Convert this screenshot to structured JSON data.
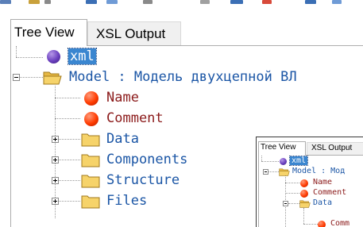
{
  "tabs": [
    {
      "label": "Tree View",
      "active": true
    },
    {
      "label": "XSL Output",
      "active": false
    }
  ],
  "tree": {
    "root": {
      "label": "xml",
      "selected": true,
      "icon": "purple-node-icon"
    },
    "model": {
      "label": "Model  : Модель двухцепной ВЛ",
      "icon": "folder-icon",
      "expanded": true
    },
    "items": [
      {
        "label": "Name",
        "icon": "red-node-icon"
      },
      {
        "label": "Comment",
        "icon": "red-node-icon"
      },
      {
        "label": "Data",
        "icon": "folder-icon",
        "expandable": true
      },
      {
        "label": "Components",
        "icon": "folder-icon",
        "expandable": true
      },
      {
        "label": "Structure",
        "icon": "folder-icon",
        "expandable": true
      },
      {
        "label": "Files",
        "icon": "folder-icon",
        "expandable": true
      }
    ]
  },
  "inset": {
    "tabs": [
      {
        "label": "Tree View",
        "active": true
      },
      {
        "label": "XSL Output",
        "active": false
      }
    ],
    "root_label": "xml",
    "model_label": "Model : Мод",
    "items": [
      "Name",
      "Comment",
      "Data",
      "Comm"
    ]
  },
  "colors": {
    "node_text": "#8b1a1a",
    "folder_text": "#1a55a5",
    "selection": "#3a86d0"
  }
}
